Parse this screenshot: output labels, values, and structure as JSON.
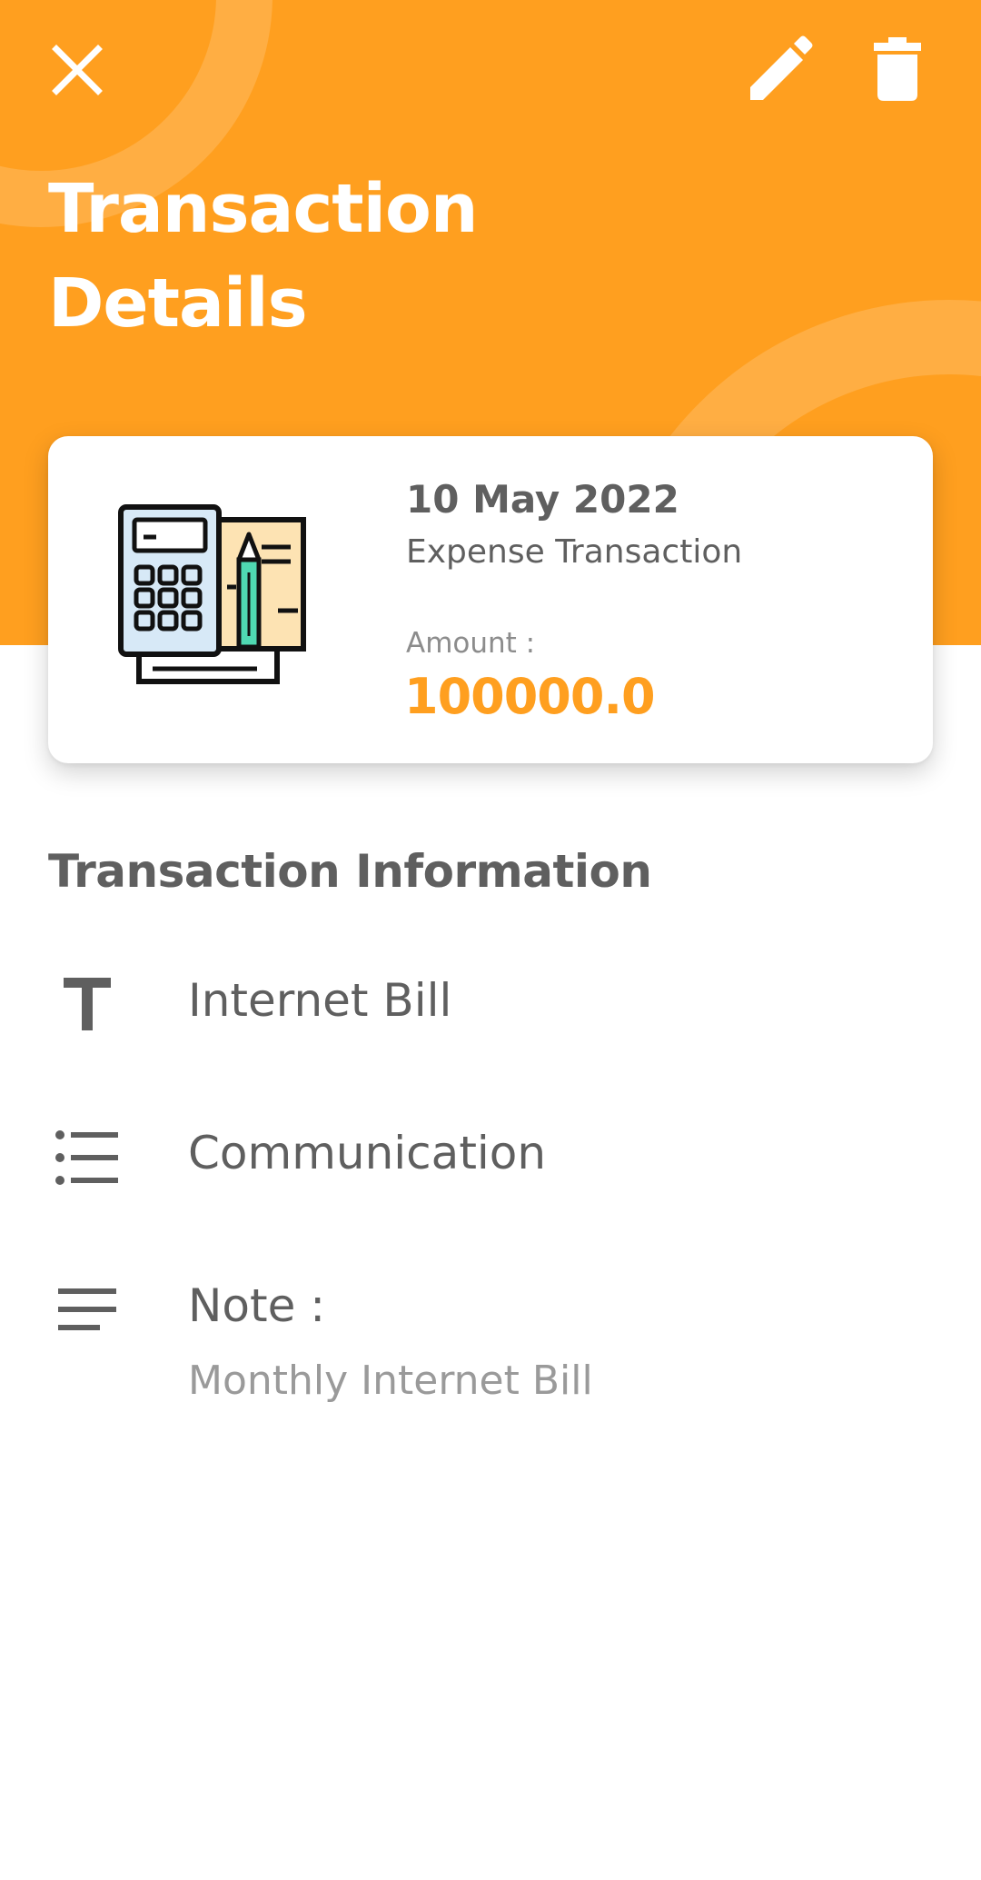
{
  "colors": {
    "header_bg": "#ff9f1f",
    "accent": "#ff9f1f",
    "text_primary": "#5f5f5f",
    "text_secondary": "#9a9a9a",
    "white": "#ffffff"
  },
  "toolbar": {
    "close_icon": "close-icon",
    "edit_icon": "pencil-icon",
    "delete_icon": "trash-icon"
  },
  "header": {
    "title": "Transaction Details"
  },
  "summary_card": {
    "illustration": "calculator-and-bill-icon",
    "date": "10 May 2022",
    "type": "Expense Transaction",
    "amount_label": "Amount :",
    "amount": "100000.0"
  },
  "details": {
    "section_title": "Transaction Information",
    "items": [
      {
        "icon": "text-icon",
        "label": "Internet Bill"
      },
      {
        "icon": "list-icon",
        "label": "Communication"
      },
      {
        "icon": "notes-icon",
        "label": "Note :",
        "value": "Monthly Internet Bill"
      }
    ]
  }
}
